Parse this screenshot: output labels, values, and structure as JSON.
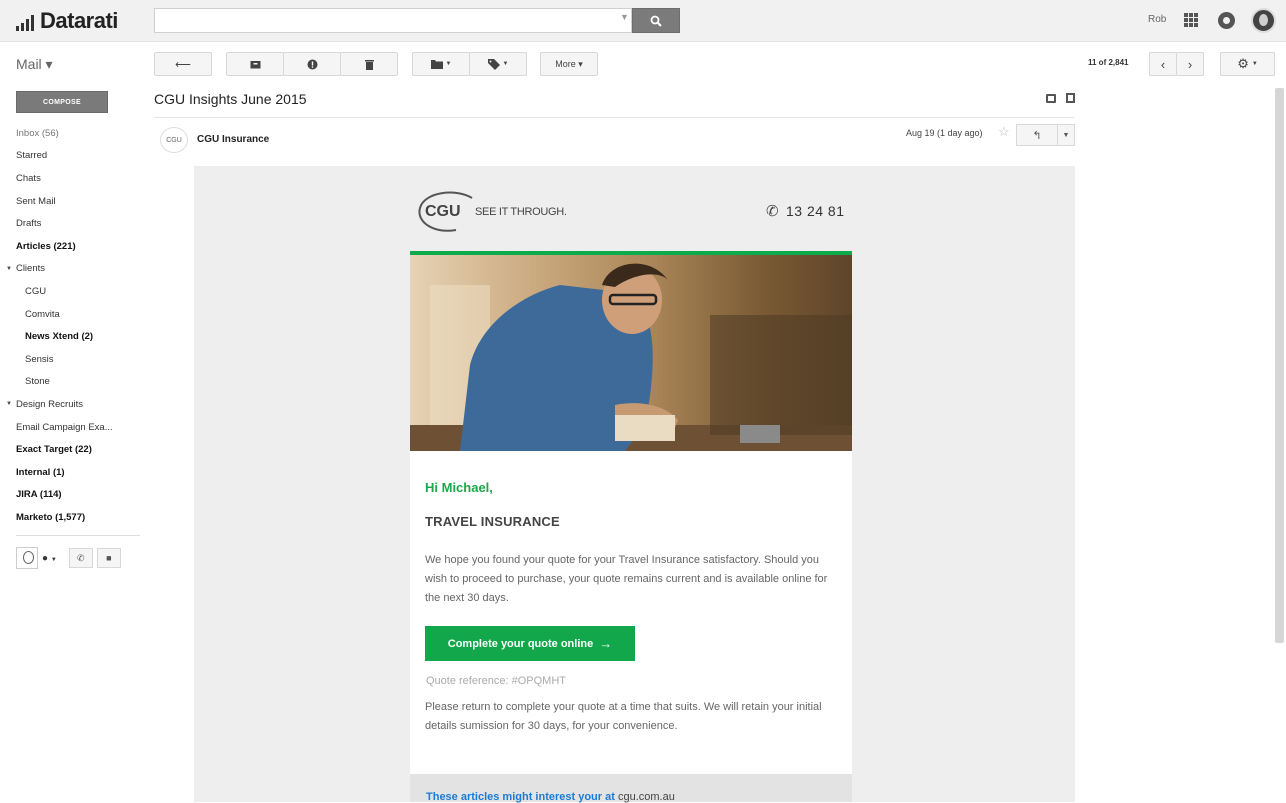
{
  "app": {
    "logo_text": "Datarati"
  },
  "topbar": {
    "search_value": "",
    "user_name": "Rob",
    "icons": [
      "search-icon",
      "apps-icon",
      "notifications-icon",
      "avatar"
    ]
  },
  "toolbar": {
    "mail_label": "Mail ▾",
    "more_label": "More ▾",
    "pager_text": "11 of 2,841",
    "icons": [
      "back-arrow-icon",
      "archive-icon",
      "report-spam-icon",
      "delete-icon",
      "folder-icon",
      "label-icon",
      "chevron-left-icon",
      "chevron-right-icon",
      "gear-icon"
    ]
  },
  "sidebar": {
    "compose_label": "COMPOSE",
    "items": [
      {
        "label": "Inbox (56)",
        "style": "muted"
      },
      {
        "label": "Starred"
      },
      {
        "label": "Chats"
      },
      {
        "label": "Sent Mail"
      },
      {
        "label": "Drafts"
      },
      {
        "label": "Articles (221)",
        "style": "bold"
      },
      {
        "label": "Clients",
        "collapse": true
      },
      {
        "label": "CGU",
        "indent": true
      },
      {
        "label": "Comvita",
        "indent": true
      },
      {
        "label": "News Xtend (2)",
        "indent": true,
        "style": "bold"
      },
      {
        "label": "Sensis",
        "indent": true
      },
      {
        "label": "Stone",
        "indent": true
      },
      {
        "label": "Design Recruits",
        "collapse": true
      },
      {
        "label": "Email Campaign Exa..."
      },
      {
        "label": "Exact Target (22)",
        "style": "bold"
      },
      {
        "label": "Internal (1)",
        "style": "bold"
      },
      {
        "label": "JIRA (114)",
        "style": "bold"
      },
      {
        "label": "Marketo (1,577)",
        "style": "bold"
      }
    ]
  },
  "message": {
    "subject": "CGU Insights June 2015",
    "sender_logo": "CGU",
    "sender": "CGU Insurance",
    "date": "Aug 19 (1 day ago)"
  },
  "email": {
    "brand": "CGU",
    "tagline": "SEE IT THROUGH.",
    "phone": "13 24 81",
    "greeting": "Hi Michael,",
    "heading": "TRAVEL INSURANCE",
    "paragraph1": "We hope you found your quote for your Travel Insurance satisfactory. Should you wish to proceed to purchase, your quote remains current and is available online for the next 30 days.",
    "cta_label": "Complete your quote online",
    "quote_reference": "Quote reference: #OPQMHT",
    "paragraph2": "Please return to complete your quote at a time that suits. We will retain your initial details sumission for 30 days, for your convenience.",
    "articles_text": "These articles might interest your at",
    "articles_site": "cgu.com.au"
  },
  "colors": {
    "accent_green": "#11a74a",
    "link_blue": "#1a7bd6",
    "compose_gray": "#7a7a7a"
  }
}
